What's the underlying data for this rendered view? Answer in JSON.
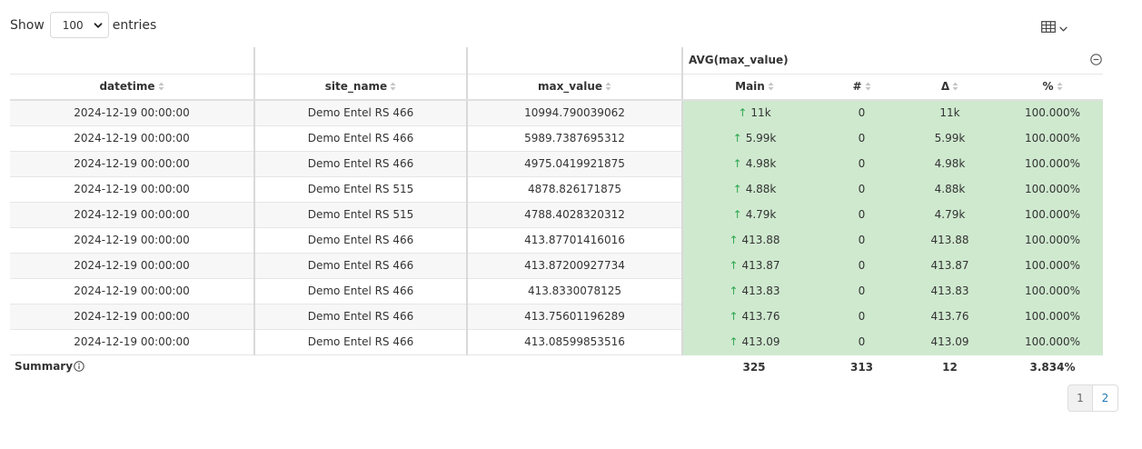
{
  "controls": {
    "show_label": "Show",
    "page_size": "100",
    "entries_label": "entries"
  },
  "icons": {
    "table_view": "table-grid-icon",
    "chevron": "chevron-down-icon",
    "collapse": "minus-circle-icon",
    "info": "info-circle-icon",
    "sort": "sort-icon",
    "trend": "arrow-up-icon"
  },
  "colors": {
    "highlight_bg": "#cfe9cf",
    "arrow_up": "#2fa84f",
    "link": "#1f78b4"
  },
  "table": {
    "group_header": "AVG(max_value)",
    "columns": [
      "datetime",
      "site_name",
      "max_value",
      "Main",
      "#",
      "Δ",
      "%"
    ],
    "rows": [
      [
        "2024-12-19 00:00:00",
        "Demo Entel RS 466",
        "10994.790039062",
        "11k",
        "0",
        "11k",
        "100.000%"
      ],
      [
        "2024-12-19 00:00:00",
        "Demo Entel RS 466",
        "5989.7387695312",
        "5.99k",
        "0",
        "5.99k",
        "100.000%"
      ],
      [
        "2024-12-19 00:00:00",
        "Demo Entel RS 466",
        "4975.0419921875",
        "4.98k",
        "0",
        "4.98k",
        "100.000%"
      ],
      [
        "2024-12-19 00:00:00",
        "Demo Entel RS 515",
        "4878.826171875",
        "4.88k",
        "0",
        "4.88k",
        "100.000%"
      ],
      [
        "2024-12-19 00:00:00",
        "Demo Entel RS 515",
        "4788.4028320312",
        "4.79k",
        "0",
        "4.79k",
        "100.000%"
      ],
      [
        "2024-12-19 00:00:00",
        "Demo Entel RS 466",
        "413.87701416016",
        "413.88",
        "0",
        "413.88",
        "100.000%"
      ],
      [
        "2024-12-19 00:00:00",
        "Demo Entel RS 466",
        "413.87200927734",
        "413.87",
        "0",
        "413.87",
        "100.000%"
      ],
      [
        "2024-12-19 00:00:00",
        "Demo Entel RS 466",
        "413.8330078125",
        "413.83",
        "0",
        "413.83",
        "100.000%"
      ],
      [
        "2024-12-19 00:00:00",
        "Demo Entel RS 466",
        "413.75601196289",
        "413.76",
        "0",
        "413.76",
        "100.000%"
      ],
      [
        "2024-12-19 00:00:00",
        "Demo Entel RS 466",
        "413.08599853516",
        "413.09",
        "0",
        "413.09",
        "100.000%"
      ]
    ],
    "summary": {
      "label": "Summary",
      "main": "325",
      "count": "313",
      "delta": "12",
      "percent": "3.834%"
    }
  },
  "pagination": {
    "pages": [
      "1",
      "2"
    ],
    "current": "1"
  }
}
